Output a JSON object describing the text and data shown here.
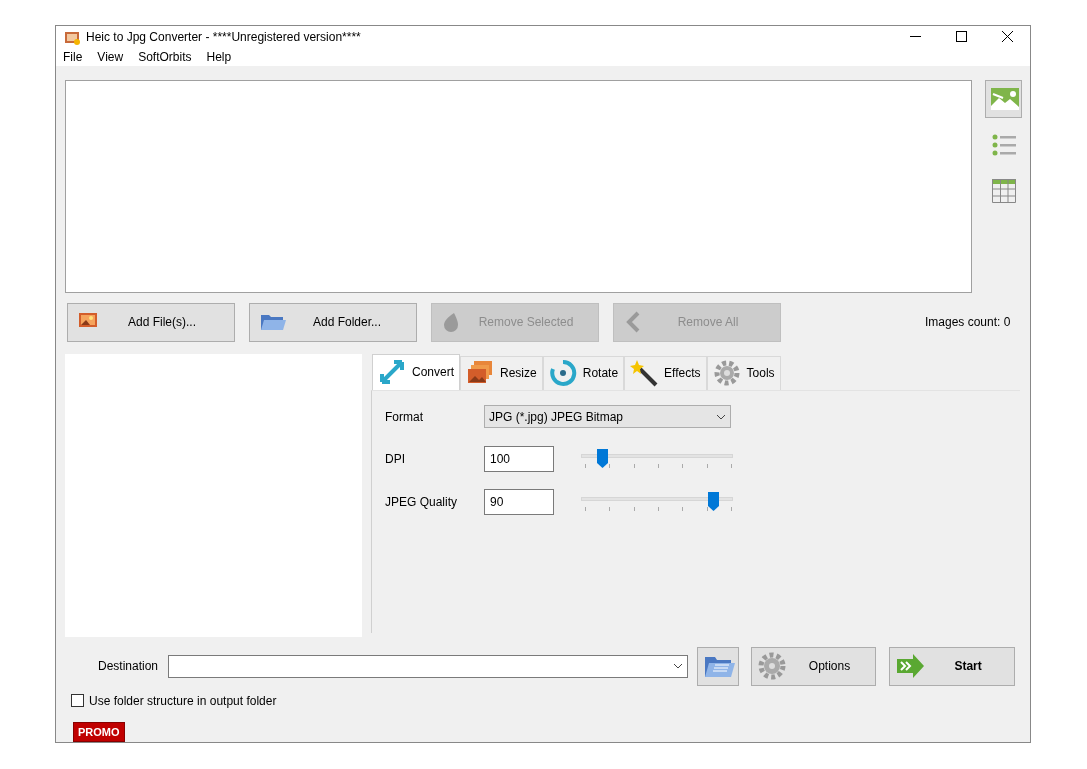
{
  "window": {
    "title": "Heic to Jpg Converter - ****Unregistered version****"
  },
  "menu": [
    "File",
    "View",
    "SoftOrbits",
    "Help"
  ],
  "view_buttons": [
    {
      "kind": "thumbnails",
      "selected": true
    },
    {
      "kind": "list",
      "selected": false
    },
    {
      "kind": "table",
      "selected": false
    }
  ],
  "file_buttons": [
    {
      "kind": "image",
      "label": "Add File(s)...",
      "disabled": false
    },
    {
      "kind": "folder",
      "label": "Add Folder...",
      "disabled": false
    },
    {
      "kind": "remove",
      "label": "Remove Selected",
      "disabled": true
    },
    {
      "kind": "back",
      "label": "Remove All",
      "disabled": true
    }
  ],
  "images_count": "Images count: 0",
  "tabs": [
    {
      "kind": "convert",
      "label": "Convert",
      "selected": true
    },
    {
      "kind": "resize",
      "label": "Resize",
      "selected": false
    },
    {
      "kind": "rotate",
      "label": "Rotate",
      "selected": false
    },
    {
      "kind": "effects",
      "label": "Effects",
      "selected": false
    },
    {
      "kind": "tools",
      "label": "Tools",
      "selected": false
    }
  ],
  "format": {
    "label": "Format",
    "value": "JPG (*.jpg) JPEG Bitmap"
  },
  "settings": [
    {
      "label": "DPI",
      "value": "100",
      "level": 0.14
    },
    {
      "label": "JPEG Quality",
      "value": "90",
      "level": 0.87
    }
  ],
  "destination": {
    "label": "Destination"
  },
  "use_folder_structure": {
    "label": "Use folder structure in output folder",
    "checked": false
  },
  "actions": [
    {
      "kind": "folder"
    },
    {
      "kind": "options",
      "label": "Options"
    },
    {
      "kind": "start",
      "label": "Start"
    }
  ],
  "promo": "PROMO"
}
